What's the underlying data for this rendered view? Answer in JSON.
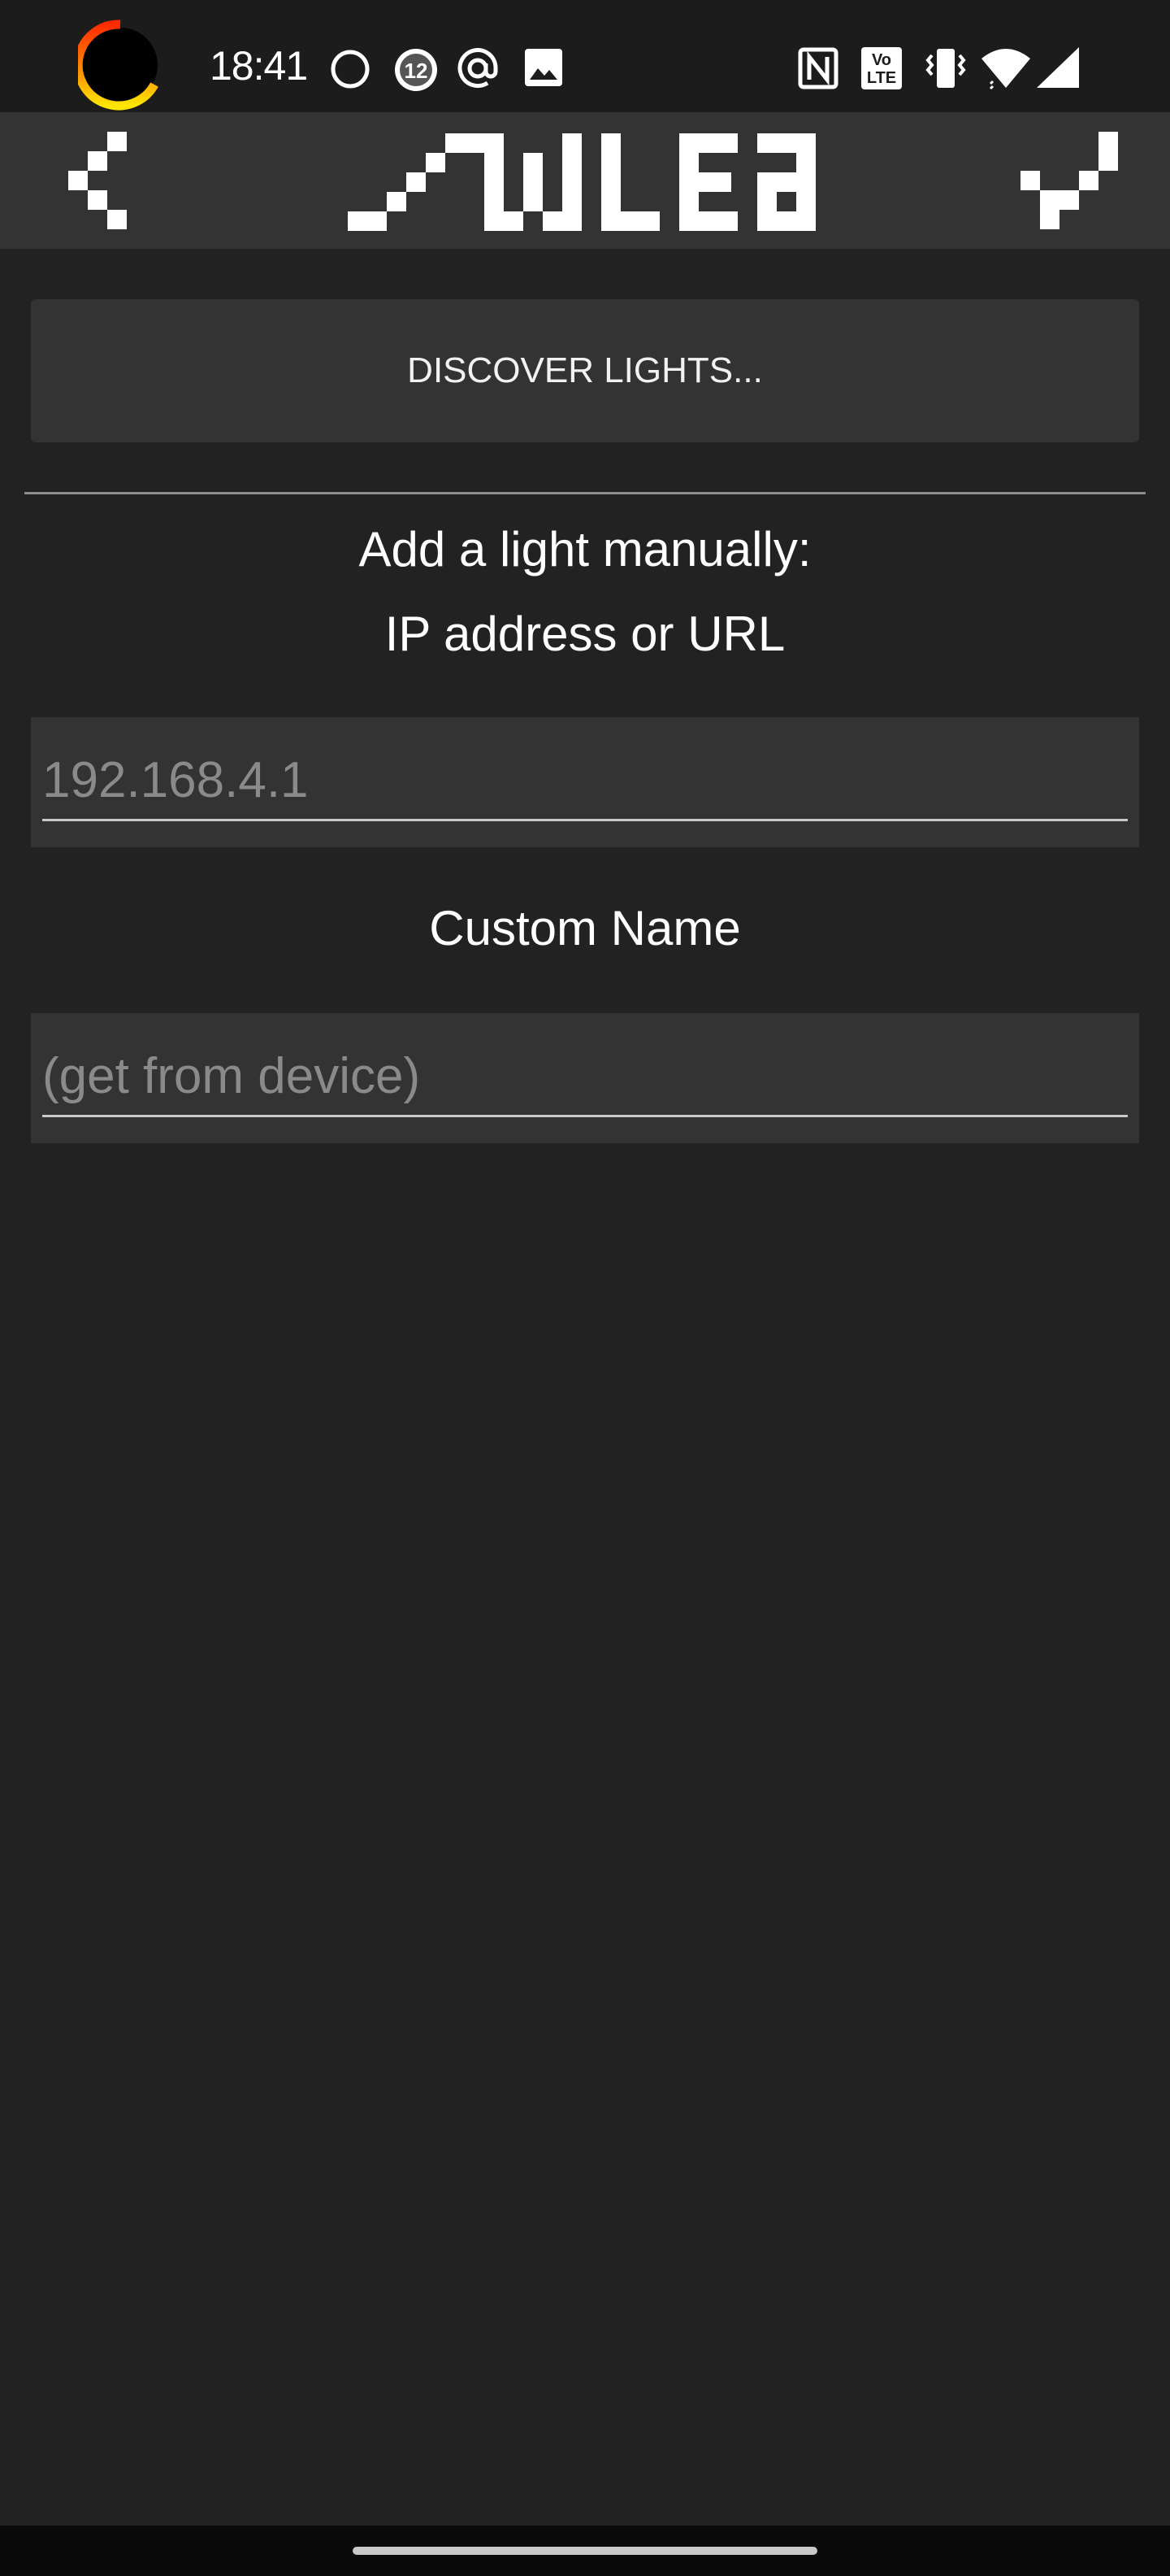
{
  "status_bar": {
    "time": "18:41",
    "notification_badge": "12",
    "left_icons": [
      "battery-ring-icon",
      "circle-icon",
      "badge-12-icon",
      "at-icon",
      "image-icon"
    ],
    "right_icons": [
      "nfc-icon",
      "volte-icon",
      "vibrate-icon",
      "wifi-icon",
      "signal-icon"
    ]
  },
  "app_bar": {
    "back_icon": "pixel-back-icon",
    "confirm_icon": "pixel-check-icon",
    "logo_icon": "pixel-logo-icon"
  },
  "main": {
    "discover_button": "DISCOVER LIGHTS...",
    "heading_line1": "Add a light manually:",
    "heading_line2": "IP address or URL",
    "ip_placeholder": "192.168.4.1",
    "custom_name_label": "Custom Name",
    "name_placeholder": "(get from device)"
  },
  "colors": {
    "background": "#222222",
    "status_bar": "#1c1c1c",
    "surface": "#333333",
    "text": "#ffffff",
    "placeholder": "#8a8a8a",
    "ring_red": "#ff2a00",
    "ring_yellow": "#ffe600"
  }
}
